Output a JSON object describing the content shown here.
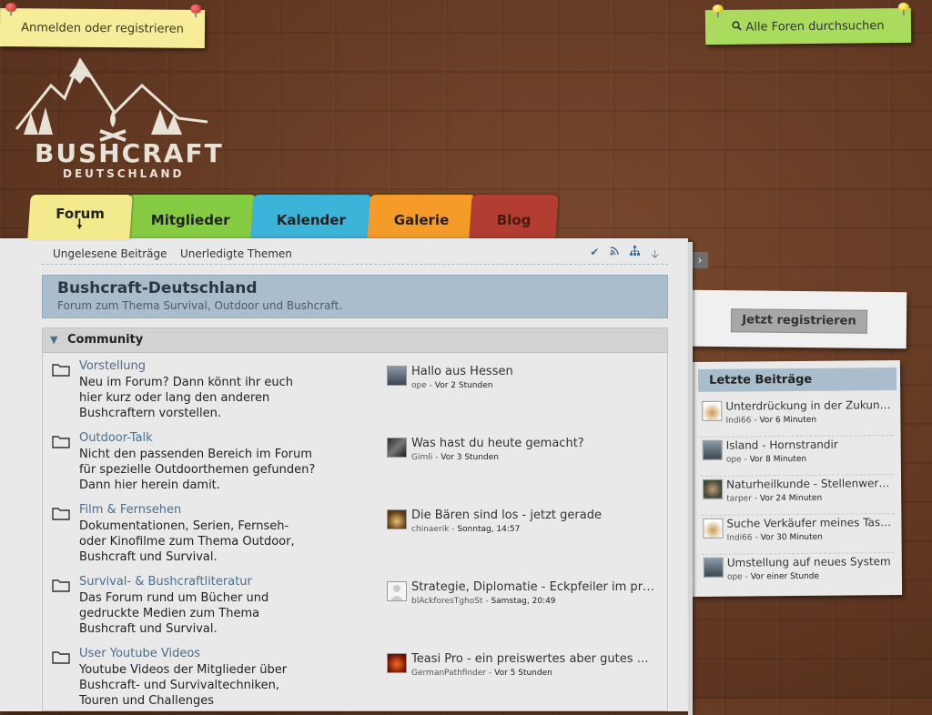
{
  "top": {
    "login_label": "Anmelden oder registrieren",
    "search_label": "Alle Foren durchsuchen"
  },
  "logo": {
    "brand": "BUSHCRAFT",
    "sub": "DEUTSCHLAND"
  },
  "tabs": [
    {
      "label": "Forum",
      "color": "#f3ea8d",
      "active": true
    },
    {
      "label": "Mitglieder",
      "color": "#86cc43"
    },
    {
      "label": "Kalender",
      "color": "#3cb3d8"
    },
    {
      "label": "Galerie",
      "color": "#f59b2a"
    },
    {
      "label": "Blog",
      "color": "#b23d32"
    }
  ],
  "subnav": {
    "unread": "Ungelesene Beiträge",
    "unsolved": "Unerledigte Themen",
    "icons": [
      "check-icon",
      "rss-icon",
      "sitemap-icon",
      "arrow-down-icon"
    ]
  },
  "board": {
    "title": "Bushcraft-Deutschland",
    "subtitle": "Forum zum Thema Survival, Outdoor und Bushcraft."
  },
  "category": {
    "label": "Community",
    "boards": [
      {
        "title": "Vorstellung",
        "desc": "Neu im Forum? Dann könnt ihr euch hier kurz oder lang den anderen Bushcraftern vorstellen.",
        "last_title": "Hallo aus Hessen",
        "last_user": "ope",
        "last_time": "Vor 2 Stunden"
      },
      {
        "title": "Outdoor-Talk",
        "desc": "Nicht den passenden Bereich im Forum für spezielle Outdoorthemen gefunden? Dann hier herein damit.",
        "last_title": "Was hast du heute gemacht?",
        "last_user": "Gimli",
        "last_time": "Vor 3 Stunden"
      },
      {
        "title": "Film & Fernsehen",
        "desc": "Dokumentationen, Serien, Fernseh- oder Kinofilme zum Thema Outdoor, Bushcraft und Survival.",
        "last_title": "Die Bären sind los - jetzt gerade",
        "last_user": "chinaerik",
        "last_time": "Sonntag, 14:57"
      },
      {
        "title": "Survival- & Bushcraftliteratur",
        "desc": "Das Forum rund um Bücher und gedruckte Medien zum Thema Bushcraft und Survival.",
        "last_title": "Strategie, Diplomatie - Eckpfeiler im pr…",
        "last_user": "blAckforesTghoSt",
        "last_time": "Samstag, 20:49"
      },
      {
        "title": "User Youtube Videos",
        "desc": "Youtube Videos der Mitglieder über Bushcraft- und Survivaltechniken, Touren und Challenges",
        "last_title": "Teasi Pro - ein preiswertes aber gutes …",
        "last_user": "GermanPathfinder",
        "last_time": "Vor 5 Stunden"
      }
    ]
  },
  "sidebar": {
    "register_label": "Jetzt registrieren",
    "recent_title": "Letzte Beiträge",
    "recent": [
      {
        "title": "Unterdrückung in der Zukun…",
        "user": "Indi66",
        "time": "Vor 6 Minuten"
      },
      {
        "title": "Island - Hornstrandir",
        "user": "ope",
        "time": "Vor 8 Minuten"
      },
      {
        "title": "Naturheilkunde - Stellenwer…",
        "user": "tarper",
        "time": "Vor 24 Minuten"
      },
      {
        "title": "Suche Verkäufer meines Tas…",
        "user": "Indi66",
        "time": "Vor 30 Minuten"
      },
      {
        "title": "Umstellung auf neues System",
        "user": "ope",
        "time": "Vor einer Stunde"
      }
    ]
  }
}
